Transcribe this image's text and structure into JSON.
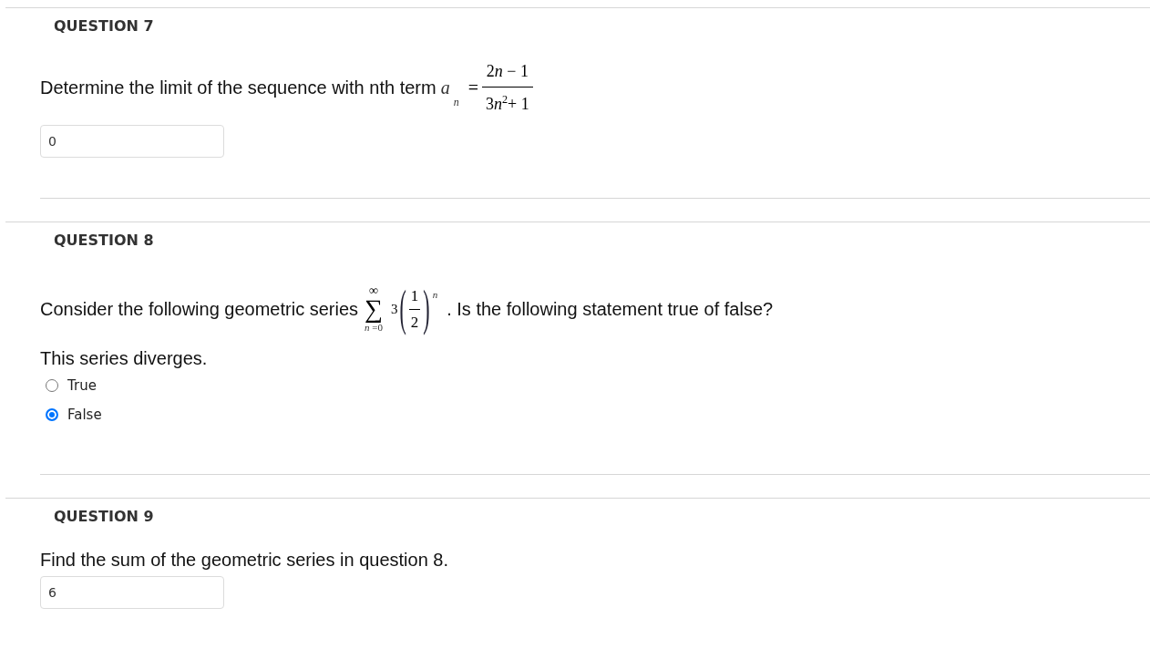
{
  "questions": [
    {
      "title": "QUESTION 7",
      "prompt": "Determine the limit of the sequence with nth term",
      "formula": {
        "kind": "fraction",
        "variable": "a",
        "subscript": "n",
        "relation": "=",
        "numerator": "2n − 1",
        "denominator": "3n$^{2}$+ 1"
      },
      "answer": "0"
    },
    {
      "title": "QUESTION 8",
      "prompt": "Consider the following geometric series",
      "formula": {
        "kind": "series",
        "upper": "∞",
        "sigma": "∑",
        "lower": "n =0",
        "coefficient": "3",
        "open_paren": "(",
        "numerator": "1",
        "denominator": "2",
        "close_paren": ")",
        "exponent": "n"
      },
      "prompt_after": ". Is the following statement true of false?",
      "statement": "This series diverges.",
      "options": [
        {
          "label": "True",
          "selected": false
        },
        {
          "label": "False",
          "selected": true
        }
      ]
    },
    {
      "title": "QUESTION 9",
      "prompt": "Find the sum of the geometric series in question 8.",
      "answer": "6"
    }
  ]
}
